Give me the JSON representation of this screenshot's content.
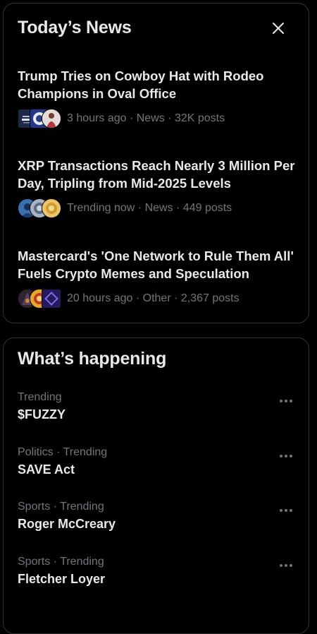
{
  "news": {
    "title": "Today’s News",
    "items": [
      {
        "headline": "Trump Tries on Cowboy Hat with Rodeo Champions in Oval Office",
        "meta": "3 hours ago · News · 32K posts"
      },
      {
        "headline": "XRP Transactions Reach Nearly 3 Million Per Day, Tripling from Mid-2025 Levels",
        "meta": "Trending now · News · 449 posts"
      },
      {
        "headline": "Mastercard's 'One Network to Rule Them All' Fuels Crypto Memes and Speculation",
        "meta": "20 hours ago · Other · 2,367 posts"
      }
    ]
  },
  "happening": {
    "title": "What’s happening",
    "trends": [
      {
        "context": "Trending",
        "name": "$FUZZY"
      },
      {
        "context": "Politics · Trending",
        "name": "SAVE Act"
      },
      {
        "context": "Sports · Trending",
        "name": "Roger McCreary"
      },
      {
        "context": "Sports · Trending",
        "name": "Fletcher Loyer"
      }
    ]
  },
  "colors": {
    "background": "#000000",
    "text_primary": "#e7e9ea",
    "text_secondary": "#71767b",
    "border": "#2f3336"
  },
  "icons": [
    "close-icon",
    "more-icon"
  ]
}
